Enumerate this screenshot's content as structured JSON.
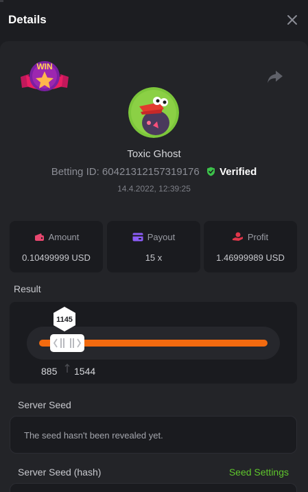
{
  "header": {
    "title": "Details",
    "close_icon": "close-icon"
  },
  "bet": {
    "badge_text": "WIN",
    "username": "Toxic Ghost",
    "betting_id_label": "Betting ID:",
    "betting_id": "60421312157319176",
    "verified_label": "Verified",
    "timestamp": "14.4.2022, 12:39:25"
  },
  "stats": [
    {
      "label": "Amount",
      "value": "0.10499999 USD",
      "icon": "wallet-icon",
      "icon_color": "#e8476f"
    },
    {
      "label": "Payout",
      "value": "15 x",
      "icon": "card-icon",
      "icon_color": "#8b5cf6"
    },
    {
      "label": "Profit",
      "value": "1.46999989 USD",
      "icon": "hand-coin-icon",
      "icon_color": "#e0364a"
    }
  ],
  "result": {
    "label": "Result",
    "value": "1145",
    "range_min": "885",
    "range_max": "1544"
  },
  "server_seed": {
    "label": "Server Seed",
    "message": "The seed hasn't been revealed yet."
  },
  "server_seed_hash": {
    "label": "Server Seed (hash)",
    "link": "Seed Settings"
  },
  "colors": {
    "accent_orange": "#f26a0f",
    "verified_green": "#3cc24a",
    "link_green": "#5fc62c"
  }
}
